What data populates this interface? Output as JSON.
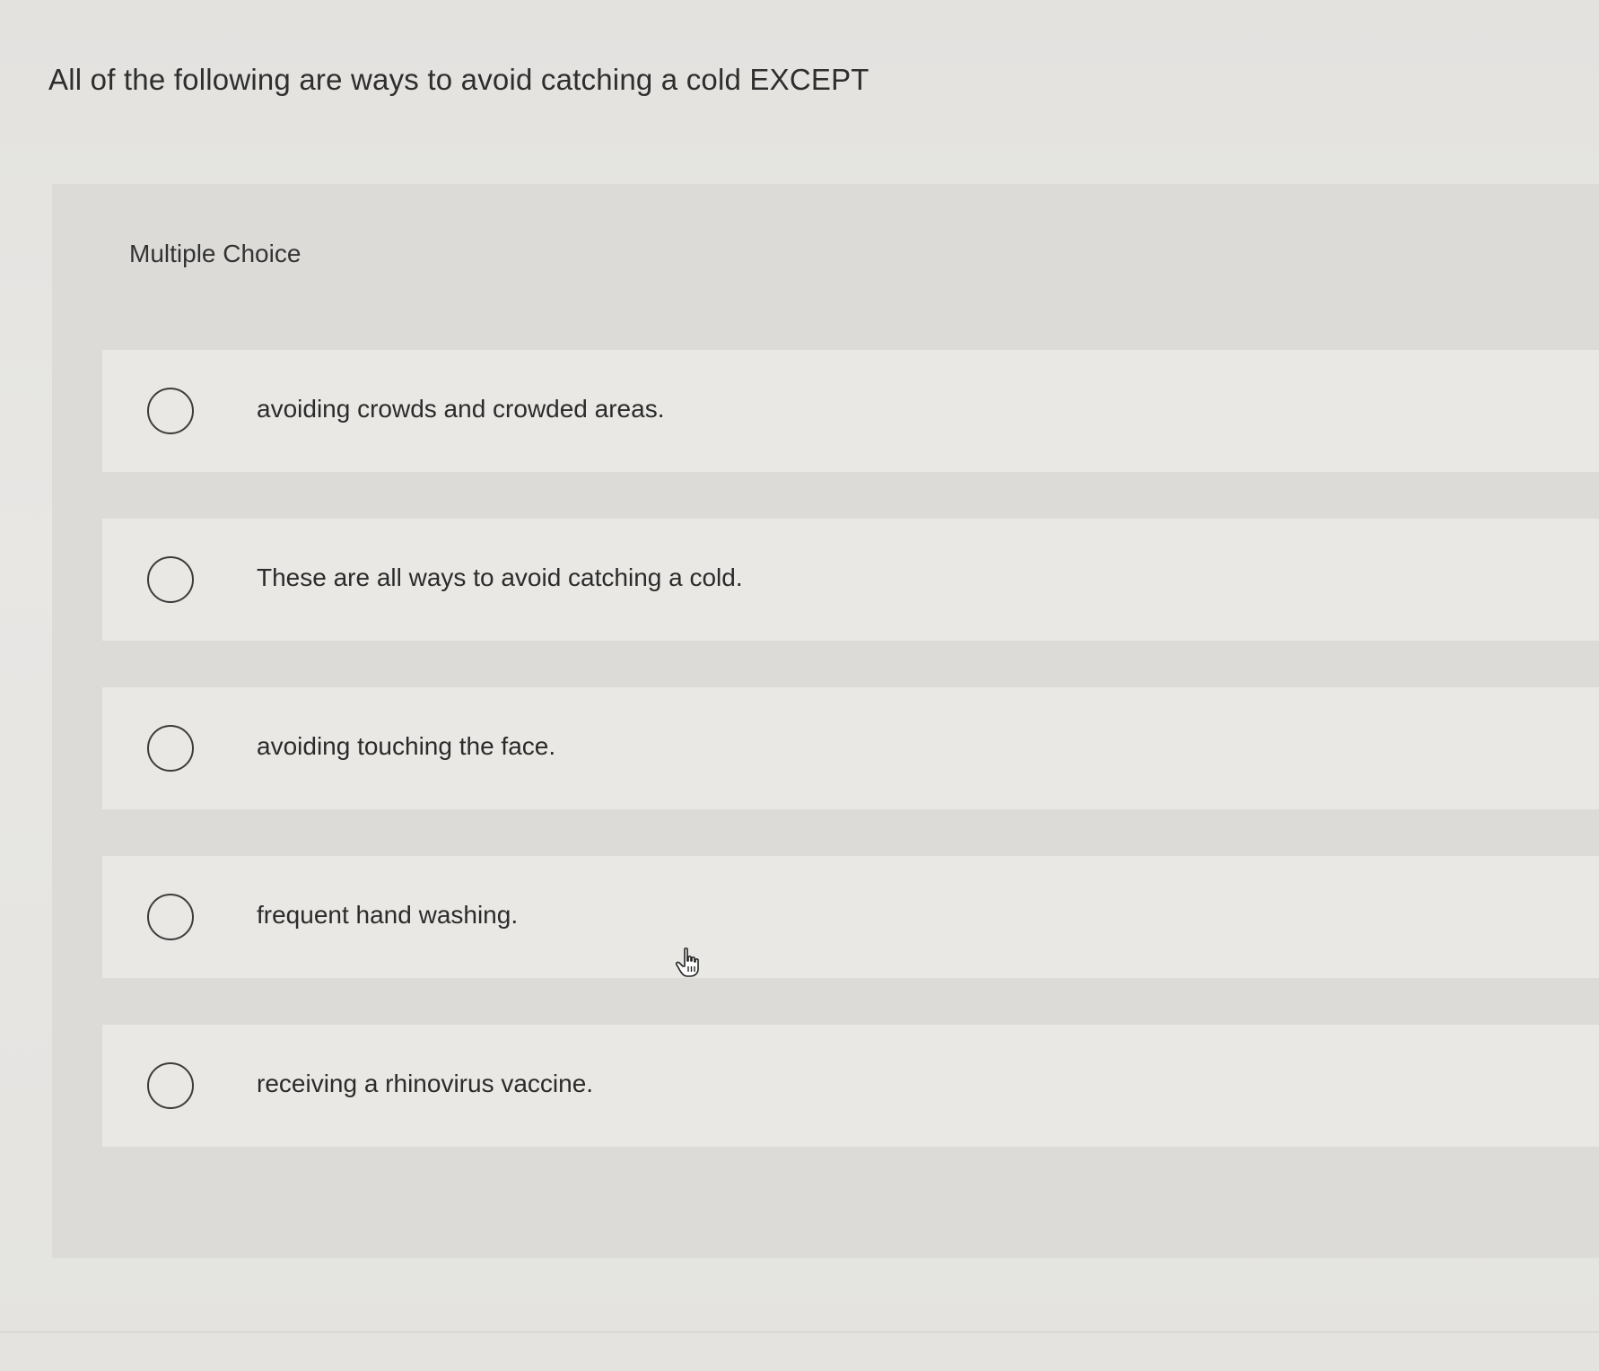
{
  "question": {
    "text": "All of the following are ways to avoid catching a cold EXCEPT"
  },
  "panel": {
    "label": "Multiple Choice"
  },
  "options": [
    {
      "label": "avoiding crowds and crowded areas.",
      "selected": false
    },
    {
      "label": "These are all ways to avoid catching a cold.",
      "selected": false
    },
    {
      "label": "avoiding touching the face.",
      "selected": false
    },
    {
      "label": "frequent hand washing.",
      "selected": false
    },
    {
      "label": "receiving a rhinovirus vaccine.",
      "selected": false
    }
  ],
  "cursor": {
    "icon": "hand-pointer-icon"
  }
}
